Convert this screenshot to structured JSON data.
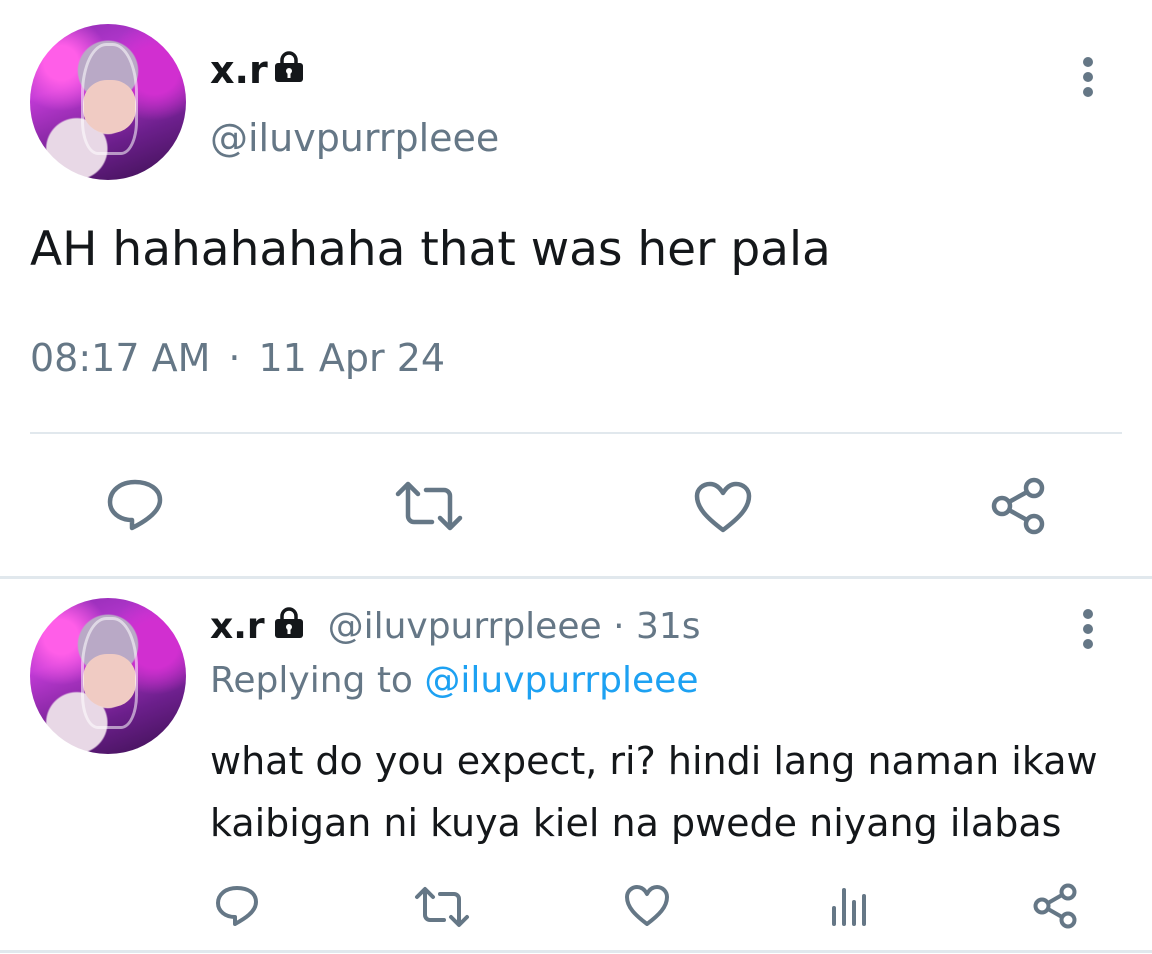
{
  "main_tweet": {
    "display_name": "x.r",
    "handle": "@iluvpurrpleee",
    "text": "AH hahahahaha that was her pala",
    "time": "08:17 AM",
    "separator": "·",
    "date": "11 Apr 24"
  },
  "reply": {
    "display_name": "x.r",
    "handle": "@iluvpurrpleee",
    "time_sep": "·",
    "age": "31s",
    "replying_label": "Replying to",
    "replying_to": "@iluvpurrpleee",
    "text": "what do you expect, ri? hindi lang naman ikaw kaibigan ni kuya kiel na pwede niyang ilabas"
  },
  "icons": {
    "protected": "lock-icon",
    "more": "more-vertical-icon",
    "reply": "reply-icon",
    "retweet": "retweet-icon",
    "like": "heart-icon",
    "share": "share-icon",
    "analytics": "analytics-icon"
  },
  "colors": {
    "text": "#14171a",
    "secondary": "#657786",
    "link": "#1da1f2",
    "divider": "#e1e8ed"
  }
}
